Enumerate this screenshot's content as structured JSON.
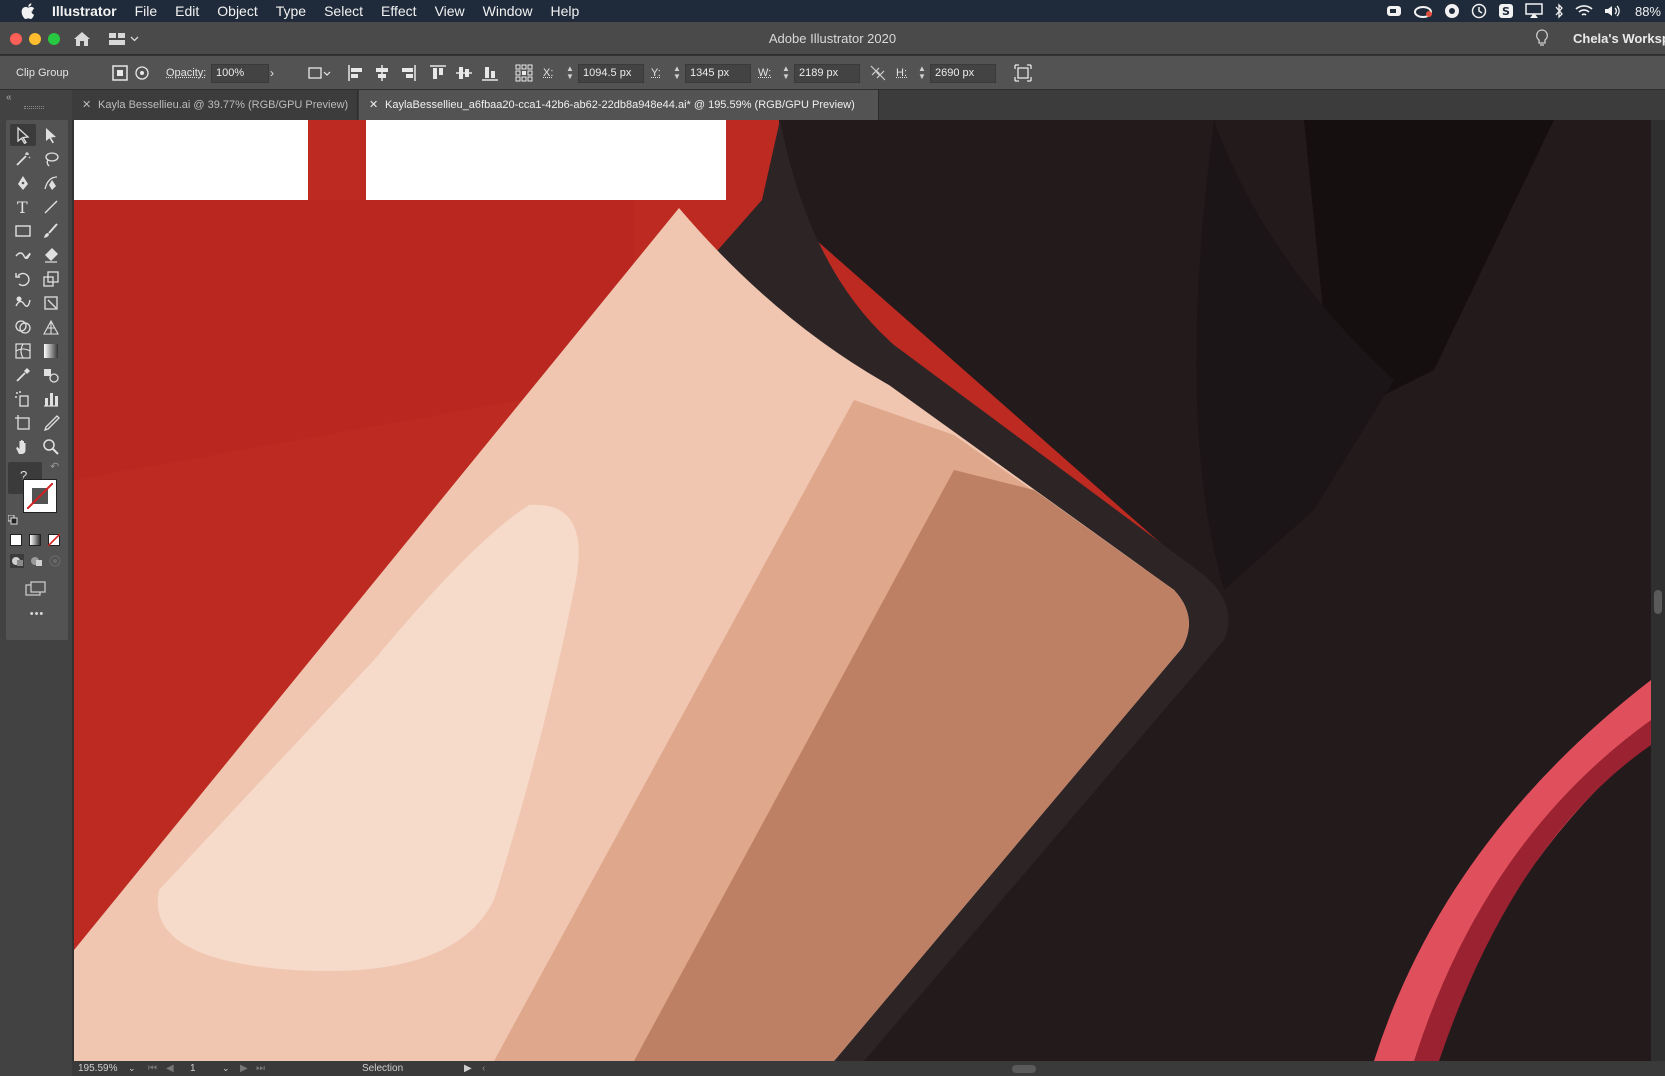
{
  "menubar": {
    "app_name": "Illustrator",
    "items": [
      "File",
      "Edit",
      "Object",
      "Type",
      "Select",
      "Effect",
      "View",
      "Window",
      "Help"
    ],
    "battery": "88%"
  },
  "titlebar": {
    "title": "Adobe Illustrator 2020",
    "workspace": "Chela's Worksp"
  },
  "controlbar": {
    "selection_type": "Clip Group",
    "opacity_label": "Opacity:",
    "opacity_value": "100%",
    "x_label": "X:",
    "x_value": "1094.5 px",
    "y_label": "Y:",
    "y_value": "1345 px",
    "w_label": "W:",
    "w_value": "2189 px",
    "h_label": "H:",
    "h_value": "2690 px"
  },
  "tabs": [
    {
      "label": "Kayla Bessellieu.ai @ 39.77% (RGB/GPU Preview)",
      "active": false
    },
    {
      "label": "KaylaBessellieu_a6fbaa20-cca1-42b6-ab62-22db8a948e44.ai* @ 195.59% (RGB/GPU Preview)",
      "active": true
    }
  ],
  "toolbar": {
    "tools": [
      "selection-tool-icon",
      "direct-selection-tool-icon",
      "magic-wand-tool-icon",
      "lasso-tool-icon",
      "pen-tool-icon",
      "curvature-tool-icon",
      "type-tool-icon",
      "line-tool-icon",
      "rectangle-tool-icon",
      "paintbrush-tool-icon",
      "shaper-tool-icon",
      "eraser-tool-icon",
      "rotate-tool-icon",
      "scale-tool-icon",
      "warp-tool-icon",
      "free-transform-tool-icon",
      "shape-builder-tool-icon",
      "perspective-grid-tool-icon",
      "mesh-tool-icon",
      "gradient-tool-icon",
      "eyedropper-tool-icon",
      "blend-tool-icon",
      "symbol-sprayer-tool-icon",
      "column-graph-tool-icon",
      "artboard-tool-icon",
      "slice-tool-icon",
      "hand-tool-icon",
      "zoom-tool-icon"
    ],
    "unknown_fill_label": "?",
    "more_label": "•••"
  },
  "statusbar": {
    "zoom": "195.59%",
    "page": "1",
    "tool": "Selection"
  },
  "colors": {
    "red": "#bd2a21",
    "skin_light": "#f0c6b0",
    "skin_mid": "#dfa78c",
    "skin_dark": "#bd8064",
    "dark_fabric": "#231a1c",
    "outline": "#2d2426",
    "pink": "#e0505c",
    "pink_dark": "#9b2230"
  }
}
